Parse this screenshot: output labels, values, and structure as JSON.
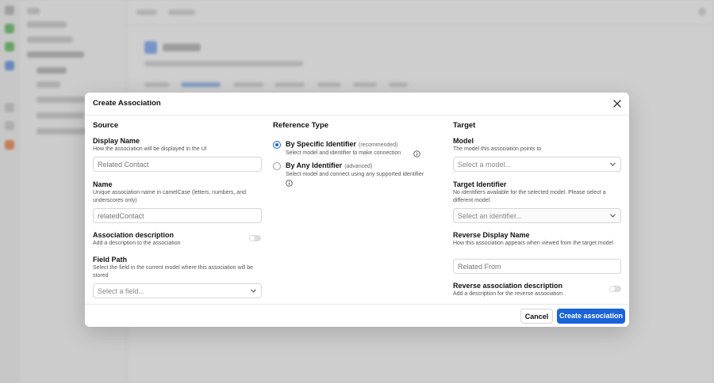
{
  "modal": {
    "title": "Create Association",
    "source": {
      "title": "Source",
      "display_name": {
        "label": "Display Name",
        "help": "How the association will be displayed in the UI",
        "placeholder": "Related Contact"
      },
      "name": {
        "label": "Name",
        "help": "Unique association name in camelCase (letters, numbers, and underscores only)",
        "placeholder": "relatedContact"
      },
      "association_description": {
        "label": "Association description",
        "help": "Add a description to the association",
        "enabled": false
      },
      "field_path": {
        "label": "Field Path",
        "help": "Select the field in the current model where this association will be stored",
        "placeholder": "Select a field..."
      }
    },
    "reference_type": {
      "title": "Reference Type",
      "options": [
        {
          "label": "By Specific Identifier",
          "tag": "(recommended)",
          "help": "Select model and identifier to make connection",
          "selected": true
        },
        {
          "label": "By Any Identifier",
          "tag": "(advanced)",
          "help": "Select model and connect using any supported identifier",
          "selected": false
        }
      ]
    },
    "target": {
      "title": "Target",
      "model": {
        "label": "Model",
        "help": "The model this association points to",
        "placeholder": "Select a model..."
      },
      "target_identifier": {
        "label": "Target Identifier",
        "help": "No identifiers available for the selected model. Please select a different model.",
        "placeholder": "Select an identifier..."
      },
      "reverse_display_name": {
        "label": "Reverse Display Name",
        "help": "How this association appears when viewed from the target model",
        "placeholder": "Related From"
      },
      "reverse_description": {
        "label": "Reverse association description",
        "help": "Add a description for the reverse association",
        "enabled": false
      }
    },
    "footer": {
      "cancel": "Cancel",
      "submit": "Create association"
    }
  },
  "colors": {
    "primary": "#1a63d8",
    "overlay": "rgba(0,0,0,0.16)"
  }
}
